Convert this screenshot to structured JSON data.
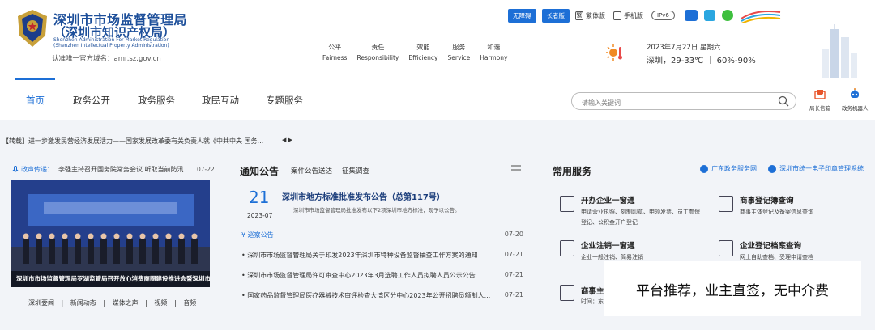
{
  "header": {
    "org_name_cn": "深圳市市场监督管理局",
    "org_name_cn2": "（深圳市知识产权局）",
    "org_name_en1": "Shenzhen Administration For Market Regulation",
    "org_name_en2": "(Shenzhen Intellectual Property Administration)",
    "domain_note": "认准唯一官方域名：amr.sz.gov.cn",
    "values": [
      {
        "cn": "公平",
        "en": "Fairness"
      },
      {
        "cn": "责任",
        "en": "Responsibility"
      },
      {
        "cn": "效能",
        "en": "Efficiency"
      },
      {
        "cn": "服务",
        "en": "Service"
      },
      {
        "cn": "和谐",
        "en": "Harmony"
      }
    ],
    "topbar": {
      "accessible": "无障碍",
      "elder": "长者版",
      "traditional": "繁体版",
      "mobile": "手机版",
      "ipv6": "IPv6"
    },
    "weather": {
      "date": "2023年7月22日 星期六",
      "info": "深圳，29-33℃ ｜ 60%-90%"
    }
  },
  "nav": {
    "items": [
      "首页",
      "政务公开",
      "政务服务",
      "政民互动",
      "专题服务"
    ],
    "search_placeholder": "请输入关键词",
    "tools": [
      "局长信箱",
      "政务机器人"
    ]
  },
  "ticker": {
    "text": "【转载】进一步激发民营经济发展活力——国家发展改革委有关负责人就《中共中央 国务...",
    "controls": "◀ ▶"
  },
  "left": {
    "feed_label": "政声传递：",
    "feed_text": "李强主持召开国务院常务会议 听取当前防汛...",
    "feed_date": "07-22",
    "photo_caption": "深圳市市场监督管理局罗湖监管局召开放心消费商圈建设推进会暨深圳市人民市...",
    "bottom_links": [
      "深圳要闻",
      "|",
      "新闻动态",
      "|",
      "媒体之声",
      "|",
      "视频",
      "|",
      "音频"
    ]
  },
  "notice": {
    "title": "通知公告",
    "tabs": [
      "案件公告送达",
      "征集调查"
    ],
    "featured": {
      "day": "21",
      "ym": "2023-07",
      "title": "深圳市地方标准批准发布公告（总第117号）",
      "desc": "深圳市市场监督管理局批准发布以下2项深圳市地方标准，现予以公告。"
    },
    "rows": [
      {
        "title": "巡察公告",
        "date": "07-20"
      },
      {
        "title": "深圳市市场监督管理局关于印发2023年深圳市特种设备监督抽查工作方案的通知",
        "date": "07-21"
      },
      {
        "title": "深圳市市场监督管理局许可审查中心2023年3月选聘工作人员拟聘人员公示公告",
        "date": "07-21"
      },
      {
        "title": "国家药品监督管理局医疗器械技术审评检查大湾区分中心2023年公开招聘员额制人...",
        "date": "07-21"
      }
    ]
  },
  "services": {
    "title": "常用服务",
    "links": [
      "广东政务服务网",
      "深圳市统一电子印章管理系统"
    ],
    "items": [
      {
        "name": "开办企业一窗通",
        "desc": "申请营业执照、刻制印章、申领发票、员工参保登记、公积金开户登记"
      },
      {
        "name": "商事登记簿查询",
        "desc": "商事主体登记及备案信息查询"
      },
      {
        "name": "企业注销一窗通",
        "desc": "企业一般注销、简易注销"
      },
      {
        "name": "企业登记档案查询",
        "desc": "网上自助查档、受理申请查档"
      },
      {
        "name": "商事主",
        "desc": "时间：东"
      }
    ]
  },
  "promo": {
    "text": "平台推荐，业主直签，无中介费"
  },
  "colors": {
    "brand_blue": "#1d6fd6",
    "title_blue": "#1d4f9a",
    "background_gray": "#f2f4f8"
  }
}
